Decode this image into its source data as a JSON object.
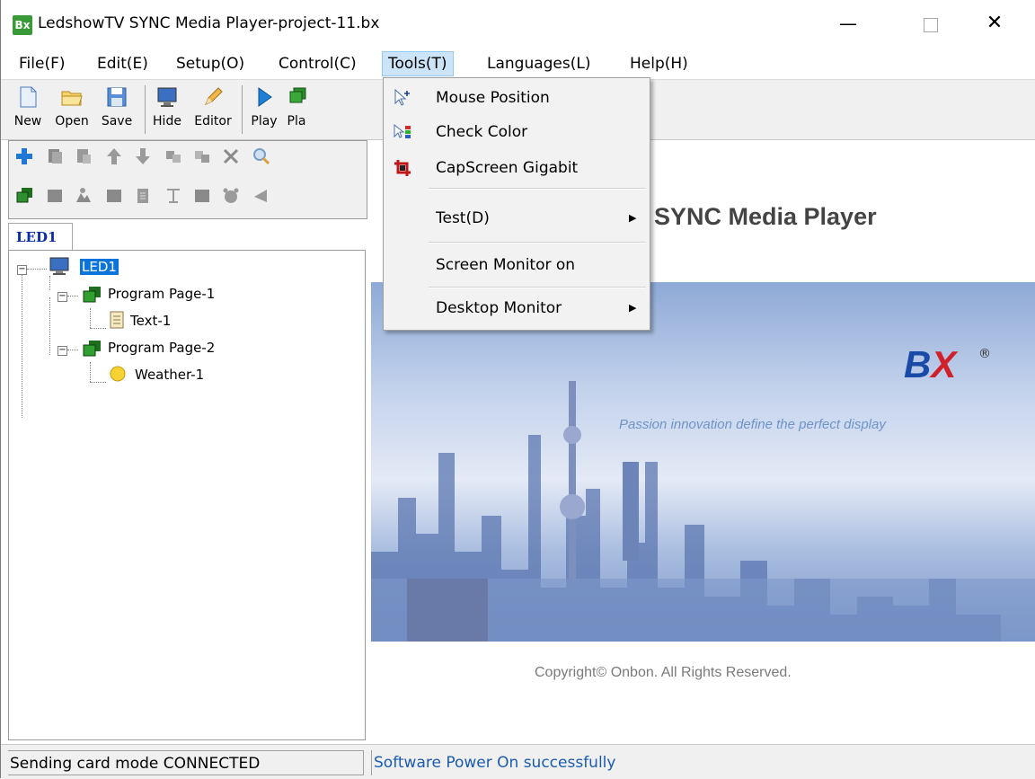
{
  "window": {
    "app_icon_text": "Bx",
    "title": "LedshowTV SYNC Media Player-project-11.bx"
  },
  "menu": [
    "File(F)",
    "Edit(E)",
    "Setup(O)",
    "Control(C)",
    "Tools(T)",
    "Languages(L)",
    "Help(H)"
  ],
  "active_menu": "Tools(T)",
  "toolbar": {
    "new": "New",
    "open": "Open",
    "save": "Save",
    "hide": "Hide",
    "editor": "Editor",
    "play": "Play",
    "play2": "Pla"
  },
  "tools_menu": {
    "mouse_position": "Mouse Position",
    "check_color": "Check Color",
    "capscreen": "CapScreen Gigabit",
    "test": "Test(D)",
    "screen_monitor": "Screen Monitor on",
    "desktop_monitor": "Desktop Monitor"
  },
  "left_tab": "LED1",
  "tree": {
    "root": "LED1",
    "page1": "Program Page-1",
    "text1": "Text-1",
    "page2": "Program Page-2",
    "weather1": "Weather-1"
  },
  "content": {
    "title": "SYNC Media Player",
    "logo_b": "B",
    "logo_x": "X",
    "registered": "®",
    "slogan": "Passion innovation define the perfect display",
    "copyright": "Copyright© Onbon. All Rights Reserved."
  },
  "status": {
    "left": "Sending card mode CONNECTED",
    "right": "Software Power On successfully"
  },
  "colors": {
    "accent_blue": "#0a74da",
    "menu_highlight": "#cce4f7",
    "status_text": "#1a5bb0"
  }
}
